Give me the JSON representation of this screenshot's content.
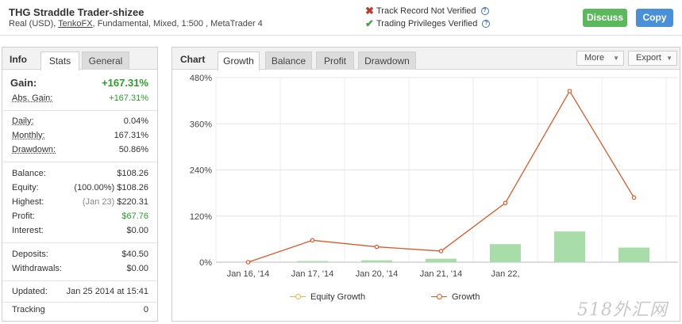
{
  "header": {
    "title": "THG Straddle Trader-shizee",
    "subtitle_prefix": "Real (USD), ",
    "broker_link": "TenkoFX",
    "subtitle_suffix": ", Fundamental, Mixed, 1:500 , MetaTrader 4",
    "track_record": "Track Record Not Verified",
    "trading_privileges": "Trading Privileges Verified",
    "discuss_label": "Discuss",
    "copy_label": "Copy"
  },
  "info": {
    "title": "Info",
    "tabs": [
      "Stats",
      "General"
    ],
    "gain_label": "Gain:",
    "gain_value": "+167.31%",
    "abs_gain_label": "Abs. Gain:",
    "abs_gain_value": "+167.31%",
    "daily_label": "Daily:",
    "daily_value": "0.04%",
    "monthly_label": "Monthly:",
    "monthly_value": "167.31%",
    "drawdown_label": "Drawdown:",
    "drawdown_value": "50.86%",
    "balance_label": "Balance:",
    "balance_value": "$108.26",
    "equity_label": "Equity:",
    "equity_note": "(100.00%)",
    "equity_value": "$108.26",
    "highest_label": "Highest:",
    "highest_note": "(Jan 23)",
    "highest_value": "$220.31",
    "profit_label": "Profit:",
    "profit_value": "$67.76",
    "interest_label": "Interest:",
    "interest_value": "$0.00",
    "deposits_label": "Deposits:",
    "deposits_value": "$40.50",
    "withdrawals_label": "Withdrawals:",
    "withdrawals_value": "$0.00",
    "updated_label": "Updated:",
    "updated_value": "Jan 25 2014 at 15:41",
    "tracking_label": "Tracking",
    "tracking_value": "0"
  },
  "chart": {
    "title": "Chart",
    "tabs": [
      "Growth",
      "Balance",
      "Profit",
      "Drawdown"
    ],
    "more_label": "More",
    "export_label": "Export",
    "legend": [
      "Equity Growth",
      "Growth"
    ]
  },
  "colors": {
    "growth_line": "#d75b2a",
    "equity_line": "#e8b64a",
    "bars": "#a8dca8",
    "positive": "#2a9d2a",
    "discuss_button": "#5cb85c",
    "copy_button": "#4a90d9"
  },
  "watermark": "518外汇网",
  "chart_data": {
    "type": "line",
    "ylim": [
      0,
      480
    ],
    "y_ticks": [
      "0%",
      "120%",
      "240%",
      "360%",
      "480%"
    ],
    "y_tick_values": [
      0,
      120,
      240,
      360,
      480
    ],
    "x_tick_labels": [
      "Jan 16, '14",
      "Jan 17, '14",
      "Jan 20, '14",
      "Jan 21, '14",
      "Jan 22,"
    ],
    "grid": true,
    "legend_position": "bottom",
    "series": [
      {
        "name": "Growth",
        "values": [
          0,
          57,
          40,
          29,
          154,
          445,
          168
        ]
      },
      {
        "name": "Equity Growth",
        "values": [
          null,
          null,
          null,
          null,
          null,
          null,
          null
        ]
      }
    ],
    "bars": [
      0,
      3,
      5,
      9,
      47,
      80,
      38
    ]
  }
}
